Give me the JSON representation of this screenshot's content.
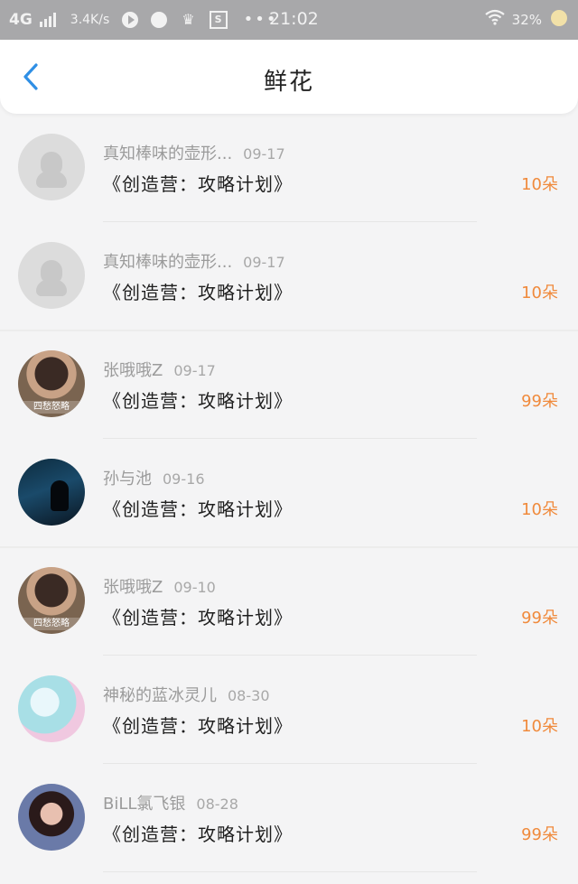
{
  "status_bar": {
    "network": "4G",
    "speed": "3.4K/s",
    "time": "21:02",
    "battery": "32%",
    "icons": [
      "signal-icon",
      "play-icon",
      "ball-icon",
      "crown-icon",
      "s-box-icon",
      "more-dots-icon",
      "wifi-icon",
      "battery-icon"
    ]
  },
  "header": {
    "title": "鲜花",
    "back_icon": "chevron-left-icon",
    "accent": "#2f8fe5"
  },
  "list": [
    {
      "name": "真知棒味的壶形...",
      "date": "09-17",
      "gift": "《创造营：攻略计划》",
      "amount": "10朵",
      "avatar": "default"
    },
    {
      "name": "真知棒味的壶形...",
      "date": "09-17",
      "gift": "《创造营：攻略计划》",
      "amount": "10朵",
      "avatar": "default"
    },
    {
      "name": "张哦哦Z",
      "date": "09-17",
      "gift": "《创造营：攻略计划》",
      "amount": "99朵",
      "avatar": "photo"
    },
    {
      "name": "孙与池",
      "date": "09-16",
      "gift": "《创造营：攻略计划》",
      "amount": "10朵",
      "avatar": "photo"
    },
    {
      "name": "张哦哦Z",
      "date": "09-10",
      "gift": "《创造营：攻略计划》",
      "amount": "99朵",
      "avatar": "photo"
    },
    {
      "name": "神秘的蓝冰灵儿",
      "date": "08-30",
      "gift": "《创造营：攻略计划》",
      "amount": "10朵",
      "avatar": "photo"
    },
    {
      "name": "BiLL氯飞银",
      "date": "08-28",
      "gift": "《创造营：攻略计划》",
      "amount": "99朵",
      "avatar": "photo"
    }
  ],
  "avatar_banner": "四愁怒略",
  "colors": {
    "amount": "#f08a3c",
    "name": "#9b9b9b",
    "gift": "#1f1f1f"
  }
}
